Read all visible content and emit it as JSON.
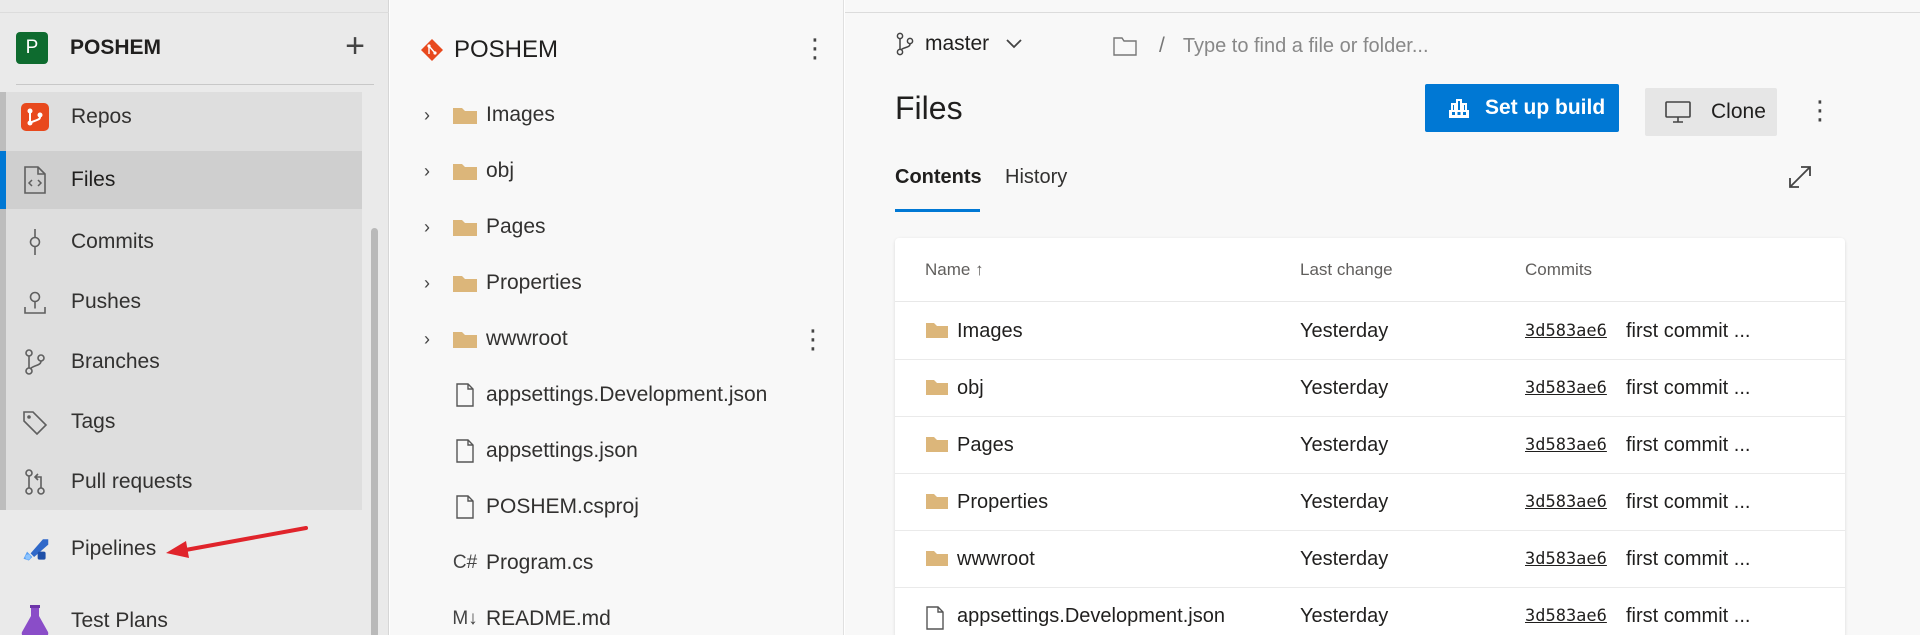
{
  "org": {
    "avatar_letter": "P",
    "name": "POSHEM"
  },
  "nav": {
    "items": [
      {
        "label": "Repos",
        "icon": "repos-icon"
      },
      {
        "label": "Files",
        "icon": "files-icon"
      },
      {
        "label": "Commits",
        "icon": "commits-icon"
      },
      {
        "label": "Pushes",
        "icon": "pushes-icon"
      },
      {
        "label": "Branches",
        "icon": "branches-icon"
      },
      {
        "label": "Tags",
        "icon": "tags-icon"
      },
      {
        "label": "Pull requests",
        "icon": "pull-requests-icon"
      },
      {
        "label": "Pipelines",
        "icon": "pipelines-icon"
      },
      {
        "label": "Test Plans",
        "icon": "test-plans-icon"
      }
    ],
    "active": "Files"
  },
  "tree": {
    "repo": "POSHEM",
    "items": [
      {
        "label": "Images",
        "type": "folder"
      },
      {
        "label": "obj",
        "type": "folder"
      },
      {
        "label": "Pages",
        "type": "folder"
      },
      {
        "label": "Properties",
        "type": "folder"
      },
      {
        "label": "wwwroot",
        "type": "folder"
      },
      {
        "label": "appsettings.Development.json",
        "type": "file"
      },
      {
        "label": "appsettings.json",
        "type": "file"
      },
      {
        "label": "POSHEM.csproj",
        "type": "file"
      },
      {
        "label": "Program.cs",
        "type": "csharp",
        "glyph": "C#"
      },
      {
        "label": "README.md",
        "type": "markdown",
        "glyph": "M↓"
      }
    ]
  },
  "main": {
    "branch": "master",
    "path_placeholder": "Type to find a file or folder...",
    "path_slash": "/",
    "title": "Files",
    "setup_build_label": "Set up build",
    "clone_label": "Clone",
    "tabs": [
      {
        "label": "Contents"
      },
      {
        "label": "History"
      }
    ],
    "active_tab": "Contents",
    "columns": {
      "name": "Name",
      "sort_indicator": "↑",
      "last_change": "Last change",
      "commits": "Commits"
    },
    "rows": [
      {
        "name": "Images",
        "type": "folder",
        "last_change": "Yesterday",
        "hash": "3d583ae6",
        "message": "first commit ..."
      },
      {
        "name": "obj",
        "type": "folder",
        "last_change": "Yesterday",
        "hash": "3d583ae6",
        "message": "first commit ..."
      },
      {
        "name": "Pages",
        "type": "folder",
        "last_change": "Yesterday",
        "hash": "3d583ae6",
        "message": "first commit ..."
      },
      {
        "name": "Properties",
        "type": "folder",
        "last_change": "Yesterday",
        "hash": "3d583ae6",
        "message": "first commit ..."
      },
      {
        "name": "wwwroot",
        "type": "folder",
        "last_change": "Yesterday",
        "hash": "3d583ae6",
        "message": "first commit ..."
      },
      {
        "name": "appsettings.Development.json",
        "type": "file",
        "last_change": "Yesterday",
        "hash": "3d583ae6",
        "message": "first commit ..."
      }
    ]
  },
  "colors": {
    "accent": "#0078d4",
    "folder": "#dcb67a",
    "org_avatar": "#0e6b2f",
    "annotation_arrow": "#e0242b"
  }
}
